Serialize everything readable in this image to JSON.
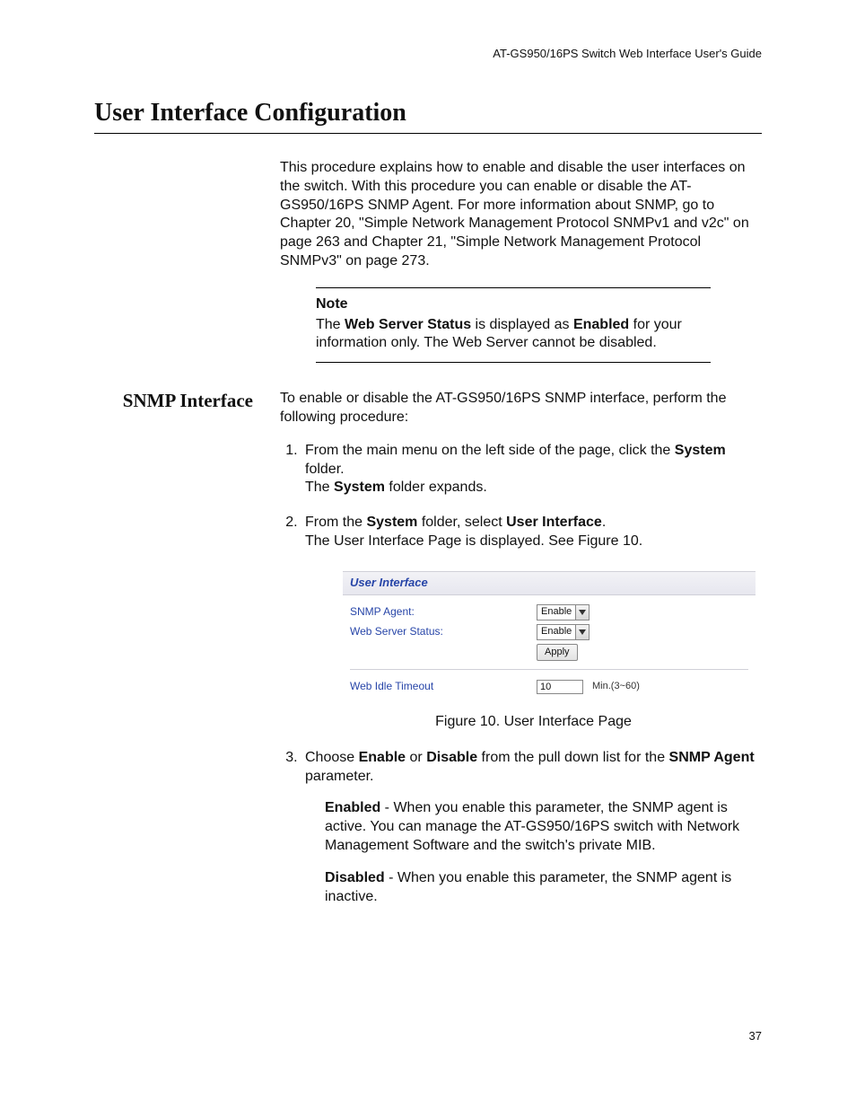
{
  "header": {
    "running_title": "AT-GS950/16PS Switch Web Interface User's Guide"
  },
  "section": {
    "title": "User Interface Configuration"
  },
  "intro": {
    "paragraph": "This procedure explains how to enable and disable the user interfaces on the switch. With this procedure you can enable or disable the AT-GS950/16PS SNMP Agent. For more information about SNMP, go to Chapter 20, \"Simple Network Management Protocol SNMPv1 and v2c\" on page 263 and Chapter 21, \"Simple Network Management Protocol SNMPv3\" on page 273."
  },
  "note": {
    "label": "Note",
    "pre": "The ",
    "bold1": "Web Server Status",
    "mid": " is displayed as ",
    "bold2": "Enabled",
    "post": " for your information only. The Web Server cannot be disabled."
  },
  "snmp": {
    "heading": "SNMP Interface",
    "lead": "To enable or disable the AT-GS950/16PS SNMP interface, perform the following procedure:",
    "step1_a": "From the main menu on the left side of the page, click the ",
    "step1_bold": "System",
    "step1_b": " folder.",
    "step1_line2a": "The ",
    "step1_line2bold": "System",
    "step1_line2b": " folder expands.",
    "step2_a": "From the ",
    "step2_bold1": "System",
    "step2_b": " folder, select ",
    "step2_bold2": "User Interface",
    "step2_c": ".",
    "step2_line2": "The User Interface Page is displayed. See Figure 10.",
    "figure_caption": "Figure 10. User Interface Page",
    "step3_a": "Choose ",
    "step3_bold1": "Enable",
    "step3_b": " or ",
    "step3_bold2": "Disable",
    "step3_c": " from the pull down list for the ",
    "step3_bold3": "SNMP Agent",
    "step3_d": " parameter.",
    "enabled_bold": "Enabled",
    "enabled_text": " - When you enable this parameter, the SNMP agent is active. You can manage the AT-GS950/16PS switch with Network Management Software and the switch's private MIB.",
    "disabled_bold": "Disabled",
    "disabled_text": " - When you enable this parameter, the SNMP agent is inactive."
  },
  "ui_panel": {
    "title": "User Interface",
    "snmp_label": "SNMP Agent:",
    "snmp_value": "Enable",
    "web_status_label": "Web Server Status:",
    "web_status_value": "Enable",
    "apply_label": "Apply",
    "timeout_label": "Web Idle Timeout",
    "timeout_value": "10",
    "timeout_hint": "Min.(3~60)"
  },
  "page_number": "37"
}
